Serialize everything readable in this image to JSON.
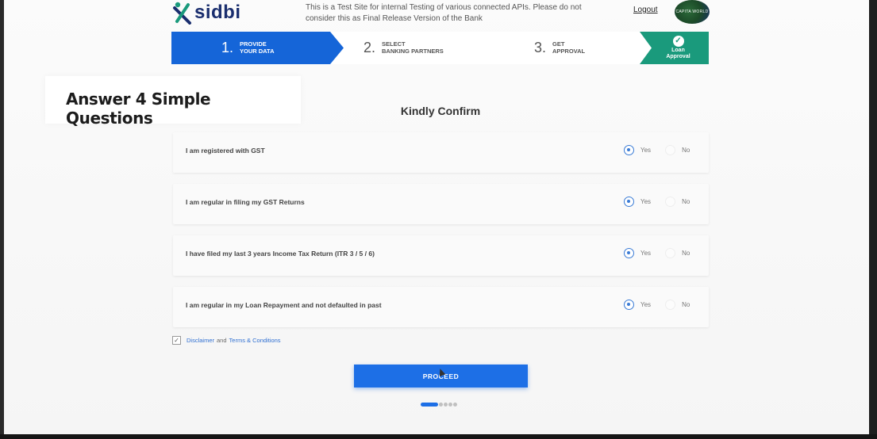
{
  "header": {
    "logo_text": "sidbi",
    "notice": "This is a Test Site for internal Testing of various connected APIs. Please do not consider this as Final Release Version of the Bank",
    "logout_label": "Logout",
    "avatar_text": "CAPITA WORLD"
  },
  "steps": [
    {
      "number": "1.",
      "line1": "PROVIDE",
      "line2": "YOUR DATA",
      "active": true
    },
    {
      "number": "2.",
      "line1": "SELECT",
      "line2": "BANKING PARTNERS",
      "active": false
    },
    {
      "number": "3.",
      "line1": "GET",
      "line2": "APPROVAL",
      "active": false
    },
    {
      "line1": "Loan",
      "line2": "Approval",
      "completed": true
    }
  ],
  "overlay_caption": "Answer 4 Simple Questions",
  "section_title": "Kindly Confirm",
  "questions": [
    {
      "text": "I am registered with GST",
      "yes": "Yes",
      "no": "No",
      "selected": "Yes"
    },
    {
      "text": "I am regular in filing my GST Returns",
      "yes": "Yes",
      "no": "No",
      "selected": "Yes"
    },
    {
      "text": "I have filed my last 3 years Income Tax Return (ITR 3 / 5 / 6)",
      "yes": "Yes",
      "no": "No",
      "selected": "Yes"
    },
    {
      "text": "I am regular in my Loan Repayment and not defaulted in past",
      "yes": "Yes",
      "no": "No",
      "selected": "Yes"
    }
  ],
  "terms": {
    "checked": true,
    "check_glyph": "✓",
    "disclaimer": "Disclaimer",
    "and": "and",
    "terms": "Terms & Conditions"
  },
  "proceed_label": "PROCEED",
  "colors": {
    "primary": "#1565d8",
    "success": "#1a9a7c"
  }
}
